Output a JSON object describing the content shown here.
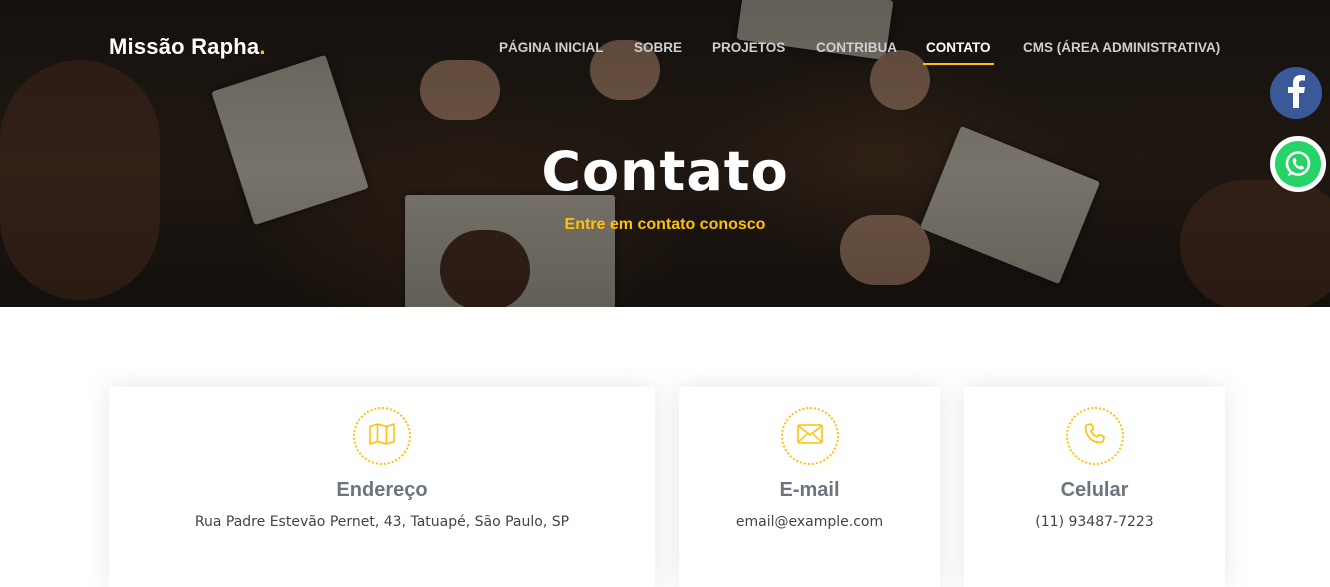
{
  "brand": {
    "name": "Missão Rapha",
    "dot": "."
  },
  "nav": {
    "items": [
      {
        "label": "PÁGINA INICIAL",
        "active": false
      },
      {
        "label": "SOBRE",
        "active": false
      },
      {
        "label": "PROJETOS",
        "active": false
      },
      {
        "label": "CONTRIBUA",
        "active": false
      },
      {
        "label": "CONTATO",
        "active": true
      },
      {
        "label": "CMS  (ÁREA ADMINISTRATIVA)",
        "active": false
      }
    ]
  },
  "hero": {
    "title": "Contato",
    "subtitle": "Entre em contato conosco"
  },
  "social": {
    "facebook_icon": "facebook-icon",
    "whatsapp_icon": "whatsapp-icon"
  },
  "cards": [
    {
      "icon": "map-icon",
      "title": "Endereço",
      "text": "Rua Padre Estevão Pernet, 43, Tatuapé, São Paulo, SP"
    },
    {
      "icon": "envelope-icon",
      "title": "E-mail",
      "text": "email@example.com"
    },
    {
      "icon": "phone-icon",
      "title": "Celular",
      "text": "(11) 93487-7223"
    }
  ],
  "colors": {
    "accent": "#ffc107",
    "heading": "#6c757d",
    "facebook": "#3b5998",
    "whatsapp": "#25d366"
  }
}
